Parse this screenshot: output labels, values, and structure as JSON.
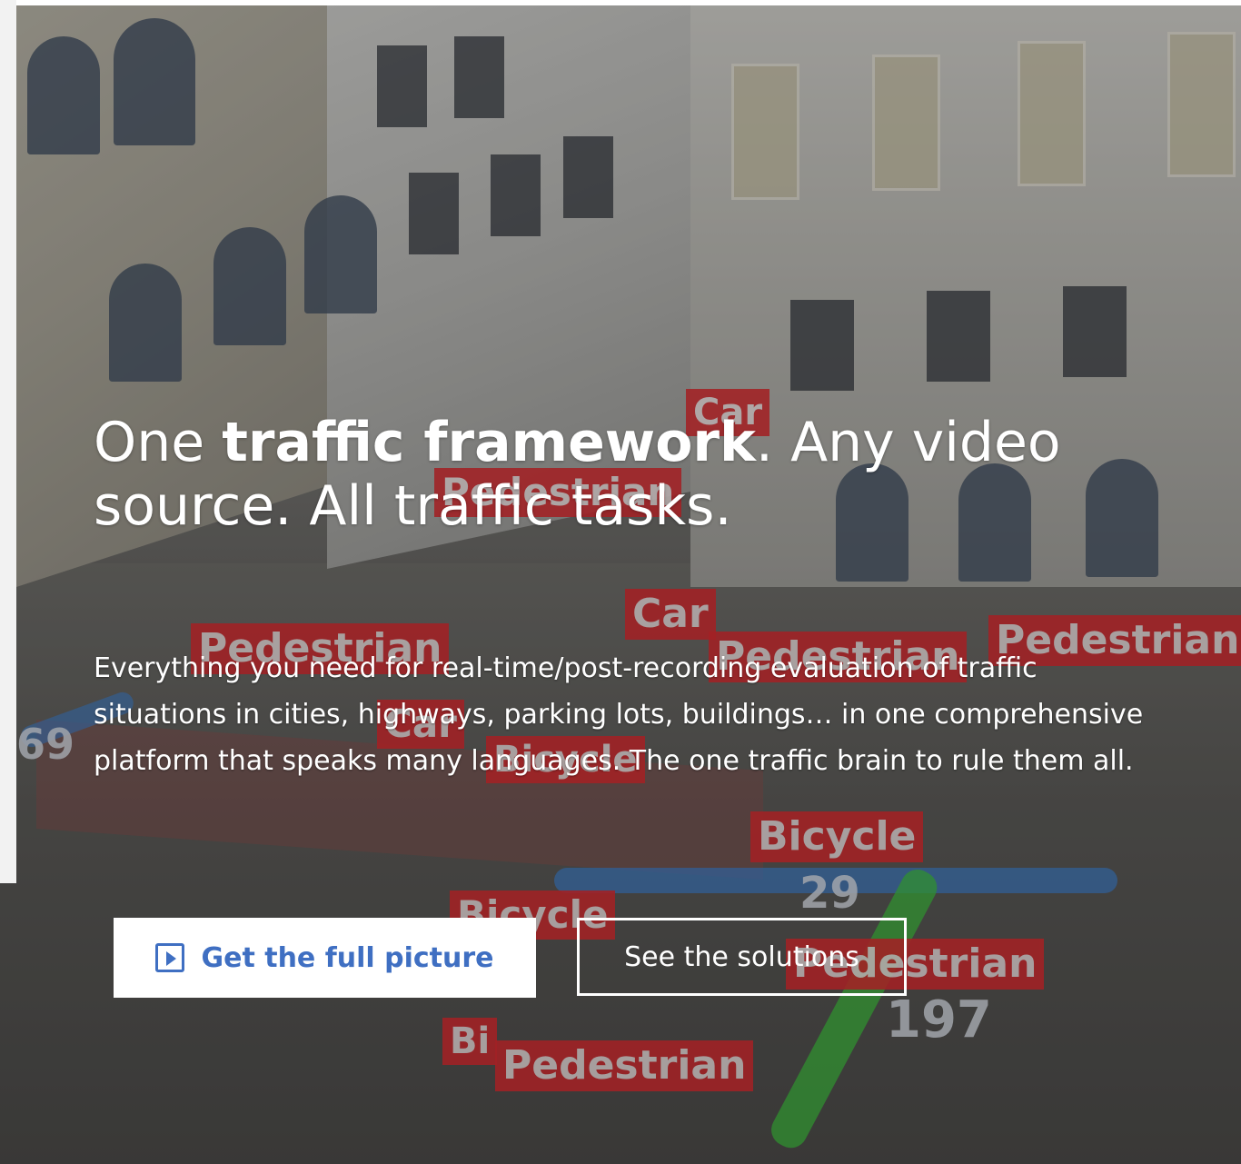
{
  "hero": {
    "headline": {
      "part1": "One ",
      "bold": "traffic framework",
      "part2": ". Any video source. All traffic tasks."
    },
    "description": "Everything you need for real-time/post-recording evaluation of traffic situations in cities, highways, parking lots, buildings… in one comprehensive platform that speaks many languages. The one traffic brain to rule them all.",
    "primary_button": {
      "label": "Get the full picture",
      "icon": "play-square-icon"
    },
    "secondary_button": {
      "label": "See the solutions"
    }
  },
  "detection_labels": [
    {
      "text": "Car"
    },
    {
      "text": "Pedestrian"
    },
    {
      "text": "Car"
    },
    {
      "text": "Pedestrian"
    },
    {
      "text": "Pedestrian"
    },
    {
      "text": "Pedestrian"
    },
    {
      "text": "Car"
    },
    {
      "text": "Bicycle"
    },
    {
      "text": "Bicycle"
    },
    {
      "text": "Bicycle"
    },
    {
      "text": "Pedestrian"
    },
    {
      "text": "Bi"
    },
    {
      "text": "Pedestrian"
    }
  ],
  "track_ids": [
    "69",
    "29",
    "197"
  ],
  "colors": {
    "label_red": "#d9262b",
    "button_blue": "#3f6fc2",
    "white": "#ffffff"
  }
}
